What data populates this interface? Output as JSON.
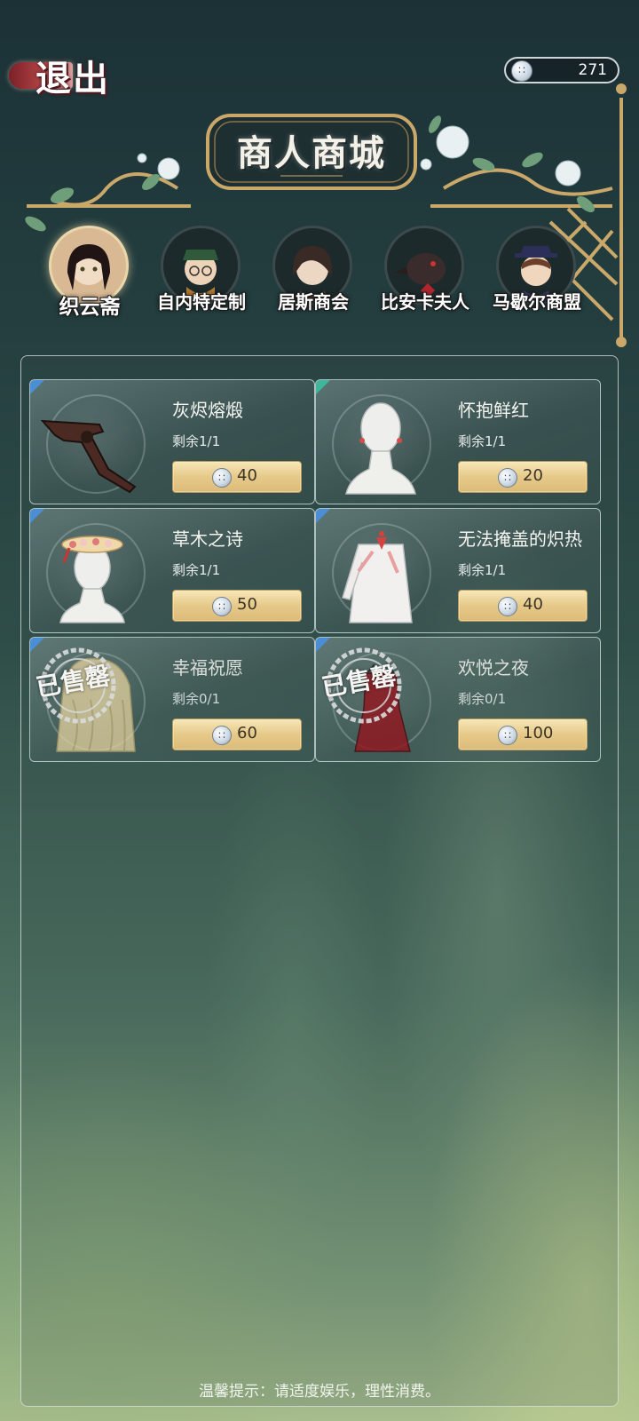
{
  "header": {
    "exit_label": "退出",
    "currency_icon": "button-coin-icon",
    "currency_value": "271",
    "title": "商人商城"
  },
  "tabs": [
    {
      "label": "织云斋",
      "active": true
    },
    {
      "label": "自内特定制",
      "active": false
    },
    {
      "label": "居斯商会",
      "active": false
    },
    {
      "label": "比安卡夫人",
      "active": false
    },
    {
      "label": "马歇尔商盟",
      "active": false
    }
  ],
  "items": [
    {
      "name": "灰烬熔煅",
      "remain": "剩余1/1",
      "price": "40",
      "sold_out": false,
      "icon": "revolver-icon"
    },
    {
      "name": "怀抱鲜红",
      "remain": "剩余1/1",
      "price": "20",
      "sold_out": false,
      "icon": "earring-mannequin-icon"
    },
    {
      "name": "草木之诗",
      "remain": "剩余1/1",
      "price": "50",
      "sold_out": false,
      "icon": "flower-hat-icon"
    },
    {
      "name": "无法掩盖的炽热",
      "remain": "剩余1/1",
      "price": "40",
      "sold_out": false,
      "icon": "ribbon-shirt-icon"
    },
    {
      "name": "幸福祝愿",
      "remain": "剩余0/1",
      "price": "60",
      "sold_out": true,
      "icon": "blonde-wig-icon"
    },
    {
      "name": "欢悦之夜",
      "remain": "剩余0/1",
      "price": "100",
      "sold_out": true,
      "icon": "red-dress-icon"
    }
  ],
  "sold_out_label": "已售罄",
  "footer_tip": "温馨提示：请适度娱乐，理性消费。",
  "colors": {
    "rarity_blue": "#4a8fd6",
    "rarity_green": "#3fb69a",
    "gold_button": "#e6c98a"
  }
}
